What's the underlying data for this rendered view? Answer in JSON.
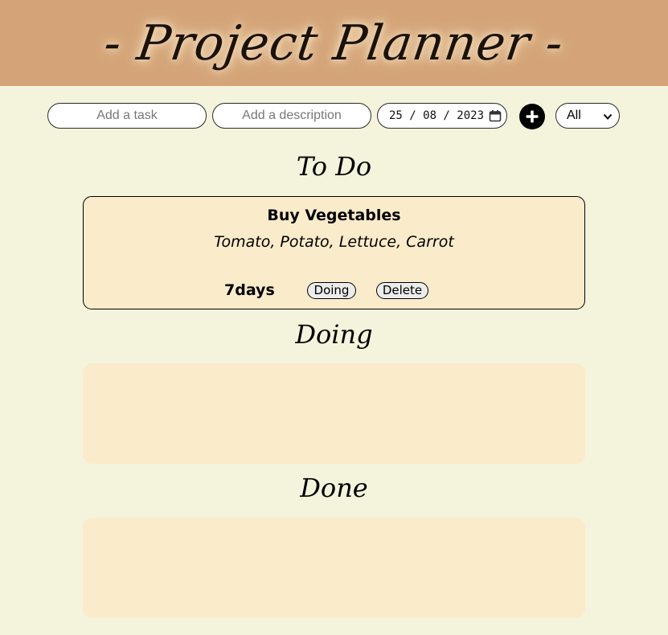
{
  "header": {
    "title": "- Project Planner -"
  },
  "toolbar": {
    "task_placeholder": "Add a task",
    "description_placeholder": "Add a description",
    "date_value": "25 / 08 / 2023",
    "add_icon": "plus-icon",
    "filter_selected": "All"
  },
  "lanes": [
    {
      "title": "To Do",
      "tasks": [
        {
          "name": "Buy Vegetables",
          "description": "Tomato, Potato, Lettuce, Carrot",
          "days": "7days",
          "move_label": "Doing",
          "delete_label": "Delete"
        }
      ]
    },
    {
      "title": "Doing",
      "tasks": []
    },
    {
      "title": "Done",
      "tasks": []
    }
  ],
  "colors": {
    "header_bg": "#d4a478",
    "page_bg": "#f4f3dc",
    "lane_bg": "#faebcb"
  }
}
